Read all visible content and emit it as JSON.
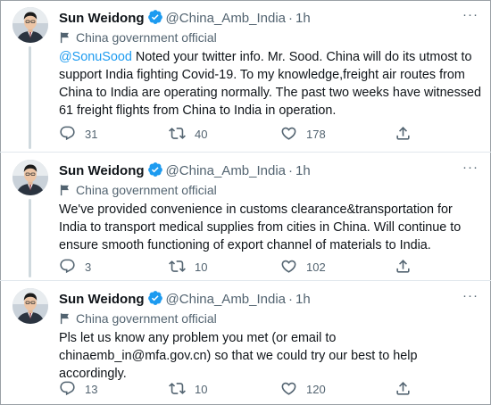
{
  "tweets": [
    {
      "author": "Sun Weidong",
      "handle": "@China_Amb_India",
      "dot": "·",
      "time": "1h",
      "label": "China government official",
      "mention": "@SonuSood",
      "text": " Noted your twitter info. Mr. Sood. China will do its utmost to support India fighting Covid-19. To my knowledge,freight air routes from China to India are operating normally. The past two weeks have witnessed 61 freight flights from China to India in operation.",
      "replies": "31",
      "retweets": "40",
      "likes": "178"
    },
    {
      "author": "Sun Weidong",
      "handle": "@China_Amb_India",
      "dot": "·",
      "time": "1h",
      "label": "China government official",
      "mention": "",
      "text": "We've provided convenience in customs clearance&transportation for India to transport medical supplies from cities in China. Will continue to ensure smooth functioning of export channel of materials to India.",
      "replies": "3",
      "retweets": "10",
      "likes": "102"
    },
    {
      "author": "Sun Weidong",
      "handle": "@China_Amb_India",
      "dot": "·",
      "time": "1h",
      "label": "China government official",
      "mention": "",
      "text": "Pls let us know any problem you met (or email to chinaemb_in@mfa.gov.cn) so that we could try our best to help accordingly.",
      "replies": "13",
      "retweets": "10",
      "likes": "120"
    }
  ],
  "icons": {
    "verified": "verified-badge-icon",
    "flag": "flag-icon",
    "more": "more-options-icon",
    "reply": "reply-icon",
    "retweet": "retweet-icon",
    "like": "heart-icon",
    "share": "share-icon"
  },
  "colors": {
    "accent": "#1d9bf0",
    "secondary_text": "#536471",
    "primary_text": "#0f1419",
    "divider": "#e1e8ed"
  },
  "more_glyph": "···"
}
